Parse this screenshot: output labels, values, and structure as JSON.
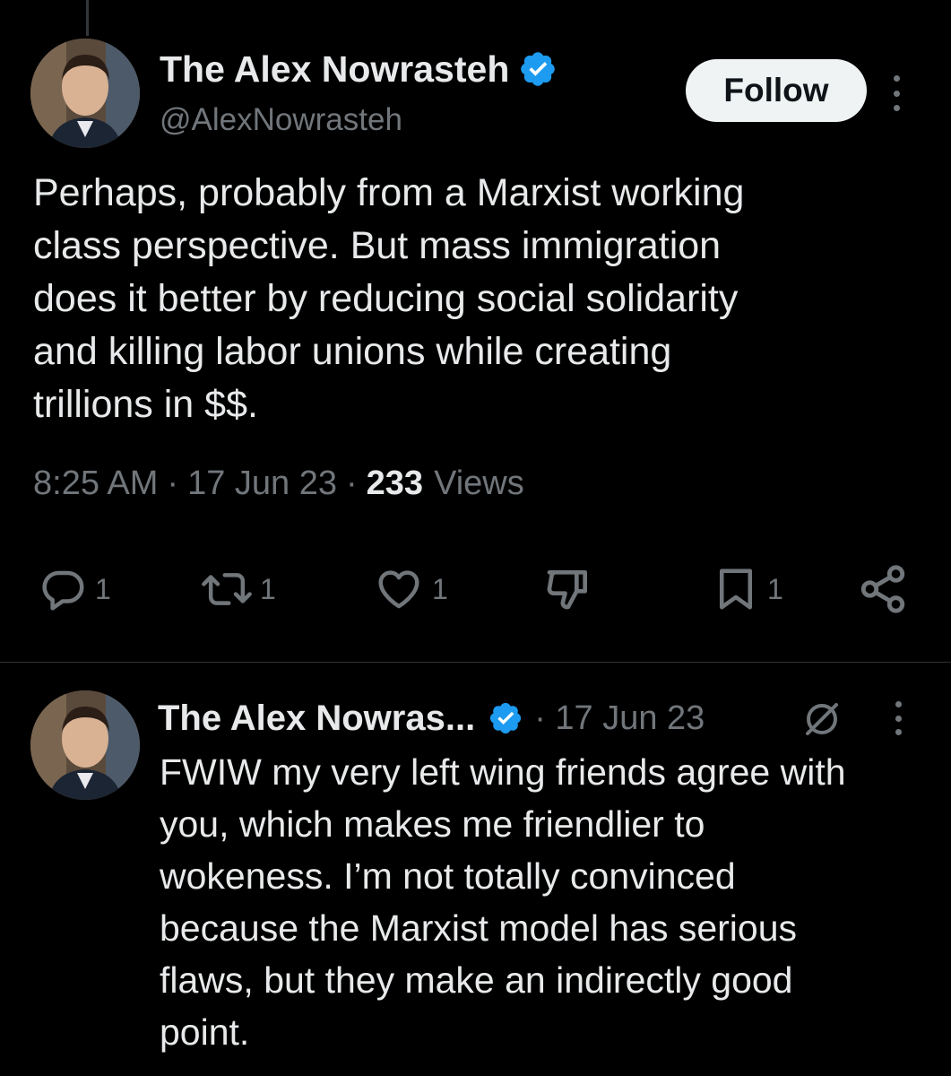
{
  "main_tweet": {
    "author_name": "The Alex Nowrasteh",
    "handle": "@AlexNowrasteh",
    "follow_label": "Follow",
    "text": "Perhaps, probably from a Marxist working\nclass perspective. But mass immigration\ndoes it better by reducing social solidarity\nand killing labor unions while creating\ntrillions in $$.",
    "time": "8:25 AM",
    "separator": "·",
    "date": "17 Jun 23",
    "views_count": "233",
    "views_label": "Views",
    "actions": {
      "reply_icon": "reply-icon",
      "reply_count": "1",
      "retweet_icon": "retweet-icon",
      "retweet_count": "1",
      "like_icon": "heart-icon",
      "like_count": "1",
      "dislike_icon": "thumbs-down-icon",
      "bookmark_icon": "bookmark-icon",
      "bookmark_count": "1",
      "share_icon": "share-icon"
    }
  },
  "reply": {
    "author_name": "The Alex Nowras...",
    "date": "· 17 Jun 23",
    "text": "FWIW my very left wing friends agree with\nyou, which makes me friendlier to\nwokeness. I’m not totally convinced\nbecause the Marxist model has serious\nflaws, but they make an indirectly good\npoint."
  },
  "colors": {
    "background": "#000000",
    "text_primary": "#e7e9ea",
    "text_secondary": "#71767b",
    "verified_blue": "#1d9bf0",
    "follow_button_bg": "#eff3f4",
    "divider": "#2f3336"
  }
}
